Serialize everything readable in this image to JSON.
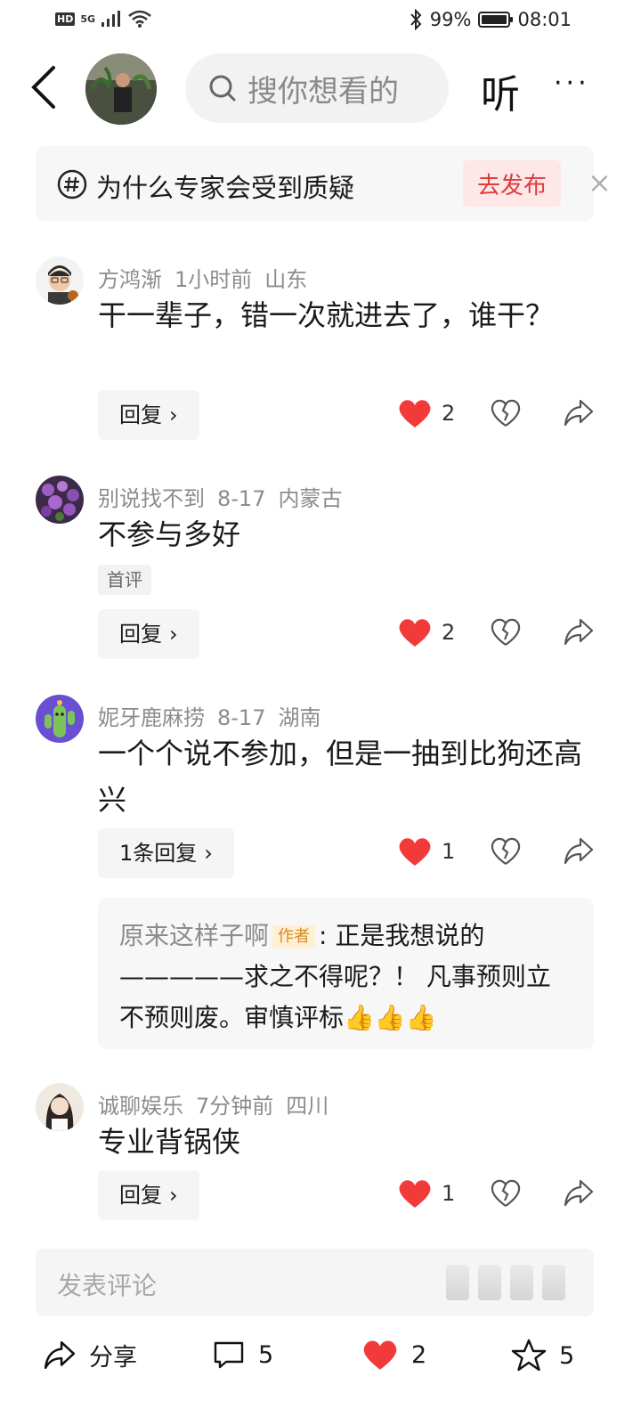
{
  "status": {
    "network_hd": "HD",
    "network_gen": "5G",
    "battery": "99%",
    "battery_level": 0.99,
    "time": "08:01"
  },
  "header": {
    "search_placeholder": "搜你想看的",
    "listen_label": "听",
    "more_label": "···"
  },
  "topic": {
    "text": "为什么专家会受到质疑",
    "publish_label": "去发布",
    "close_label": "×"
  },
  "comments": [
    {
      "user": "方鸿渐",
      "time": "1小时前",
      "location": "山东",
      "text": "干一辈子，错一次就进去了，谁干？",
      "reply_label": "回复",
      "likes": "2"
    },
    {
      "user": "别说找不到",
      "time": "8-17",
      "location": "内蒙古",
      "text": "不参与多好",
      "tag": "首评",
      "reply_label": "回复",
      "likes": "2"
    },
    {
      "user": "妮牙鹿麻捞",
      "time": "8-17",
      "location": "湖南",
      "text": "一个个说不参加，但是一抽到比狗还高兴",
      "reply_label": "1条回复",
      "likes": "1"
    },
    {
      "user": "诚聊娱乐",
      "time": "7分钟前",
      "location": "四川",
      "text": "专业背锅侠",
      "reply_label": "回复",
      "likes": "1"
    }
  ],
  "sub_reply": {
    "author": "原来这样子啊",
    "author_tag": "作者",
    "text": ": 正是我想说的—————求之不得呢？！ 凡事预则立不预则废。审慎评标",
    "emoji": "👍"
  },
  "comment_input": {
    "placeholder": "发表评论"
  },
  "bottom_bar": {
    "share_label": "分享",
    "comment_count": "5",
    "like_count": "2",
    "favorite_count": "5"
  },
  "colors": {
    "heart": "#f23a3a",
    "publish_bg": "#fde7e7",
    "publish_text": "#e03c3c",
    "author_tag": "#d88a1f"
  }
}
